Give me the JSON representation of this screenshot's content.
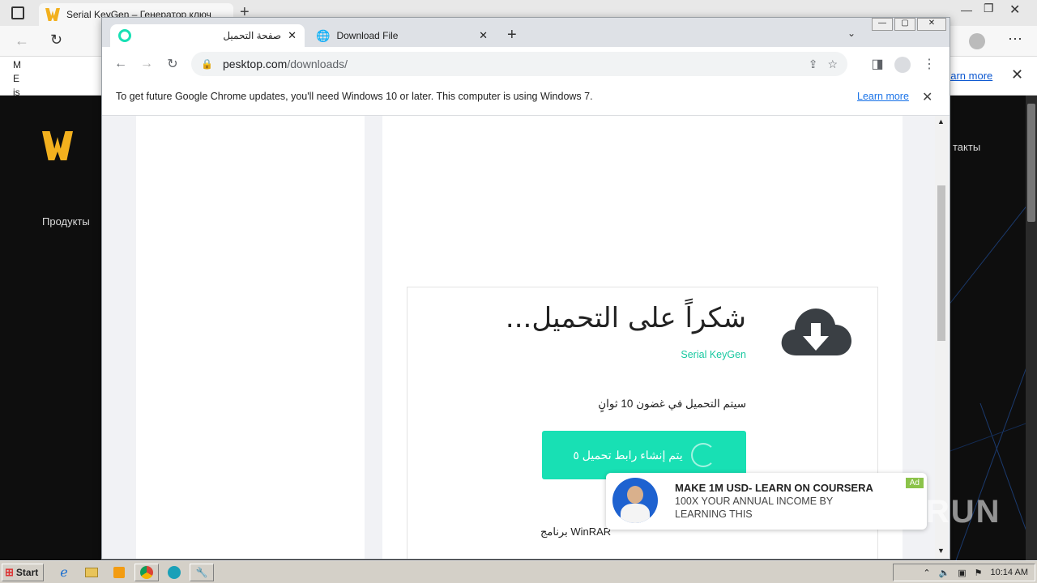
{
  "bg_window": {
    "tab_title": "Serial KeyGen – Генератор ключ",
    "info_learn_more": "earn more",
    "side_text_1": "M",
    "side_text_2": "E",
    "side_text_3": "is",
    "nav_products": "Продукты",
    "nav_contacts": "такты",
    "accent_color": "#f2b01e"
  },
  "chrome": {
    "tabs": [
      {
        "label": "صفحة التحميل",
        "icon": "pesktop-icon"
      },
      {
        "label": "Download File",
        "icon": "globe-icon"
      }
    ],
    "url_host": "pesktop.com",
    "url_path": "/downloads/",
    "info_message": "To get future Google Chrome updates, you'll need Windows 10 or later. This computer is using Windows 7.",
    "info_link": "Learn more"
  },
  "page": {
    "title": "شكراً على التحميل...",
    "subtitle": "Serial KeyGen",
    "countdown": "سيتم التحميل في غضون 10 ثوانٍ",
    "button_label": "يتم إنشاء رابط تحميل ٥",
    "winrar_text": "برنامج WinRAR",
    "accent_color": "#18e0b4"
  },
  "ad": {
    "headline": "MAKE 1M USD- LEARN ON COURSERA",
    "body": "100X YOUR ANNUAL INCOME BY LEARNING THIS",
    "badge": "Ad"
  },
  "taskbar": {
    "start_label": "Start",
    "clock": "10:14 AM"
  },
  "watermark": "ANY RUN"
}
